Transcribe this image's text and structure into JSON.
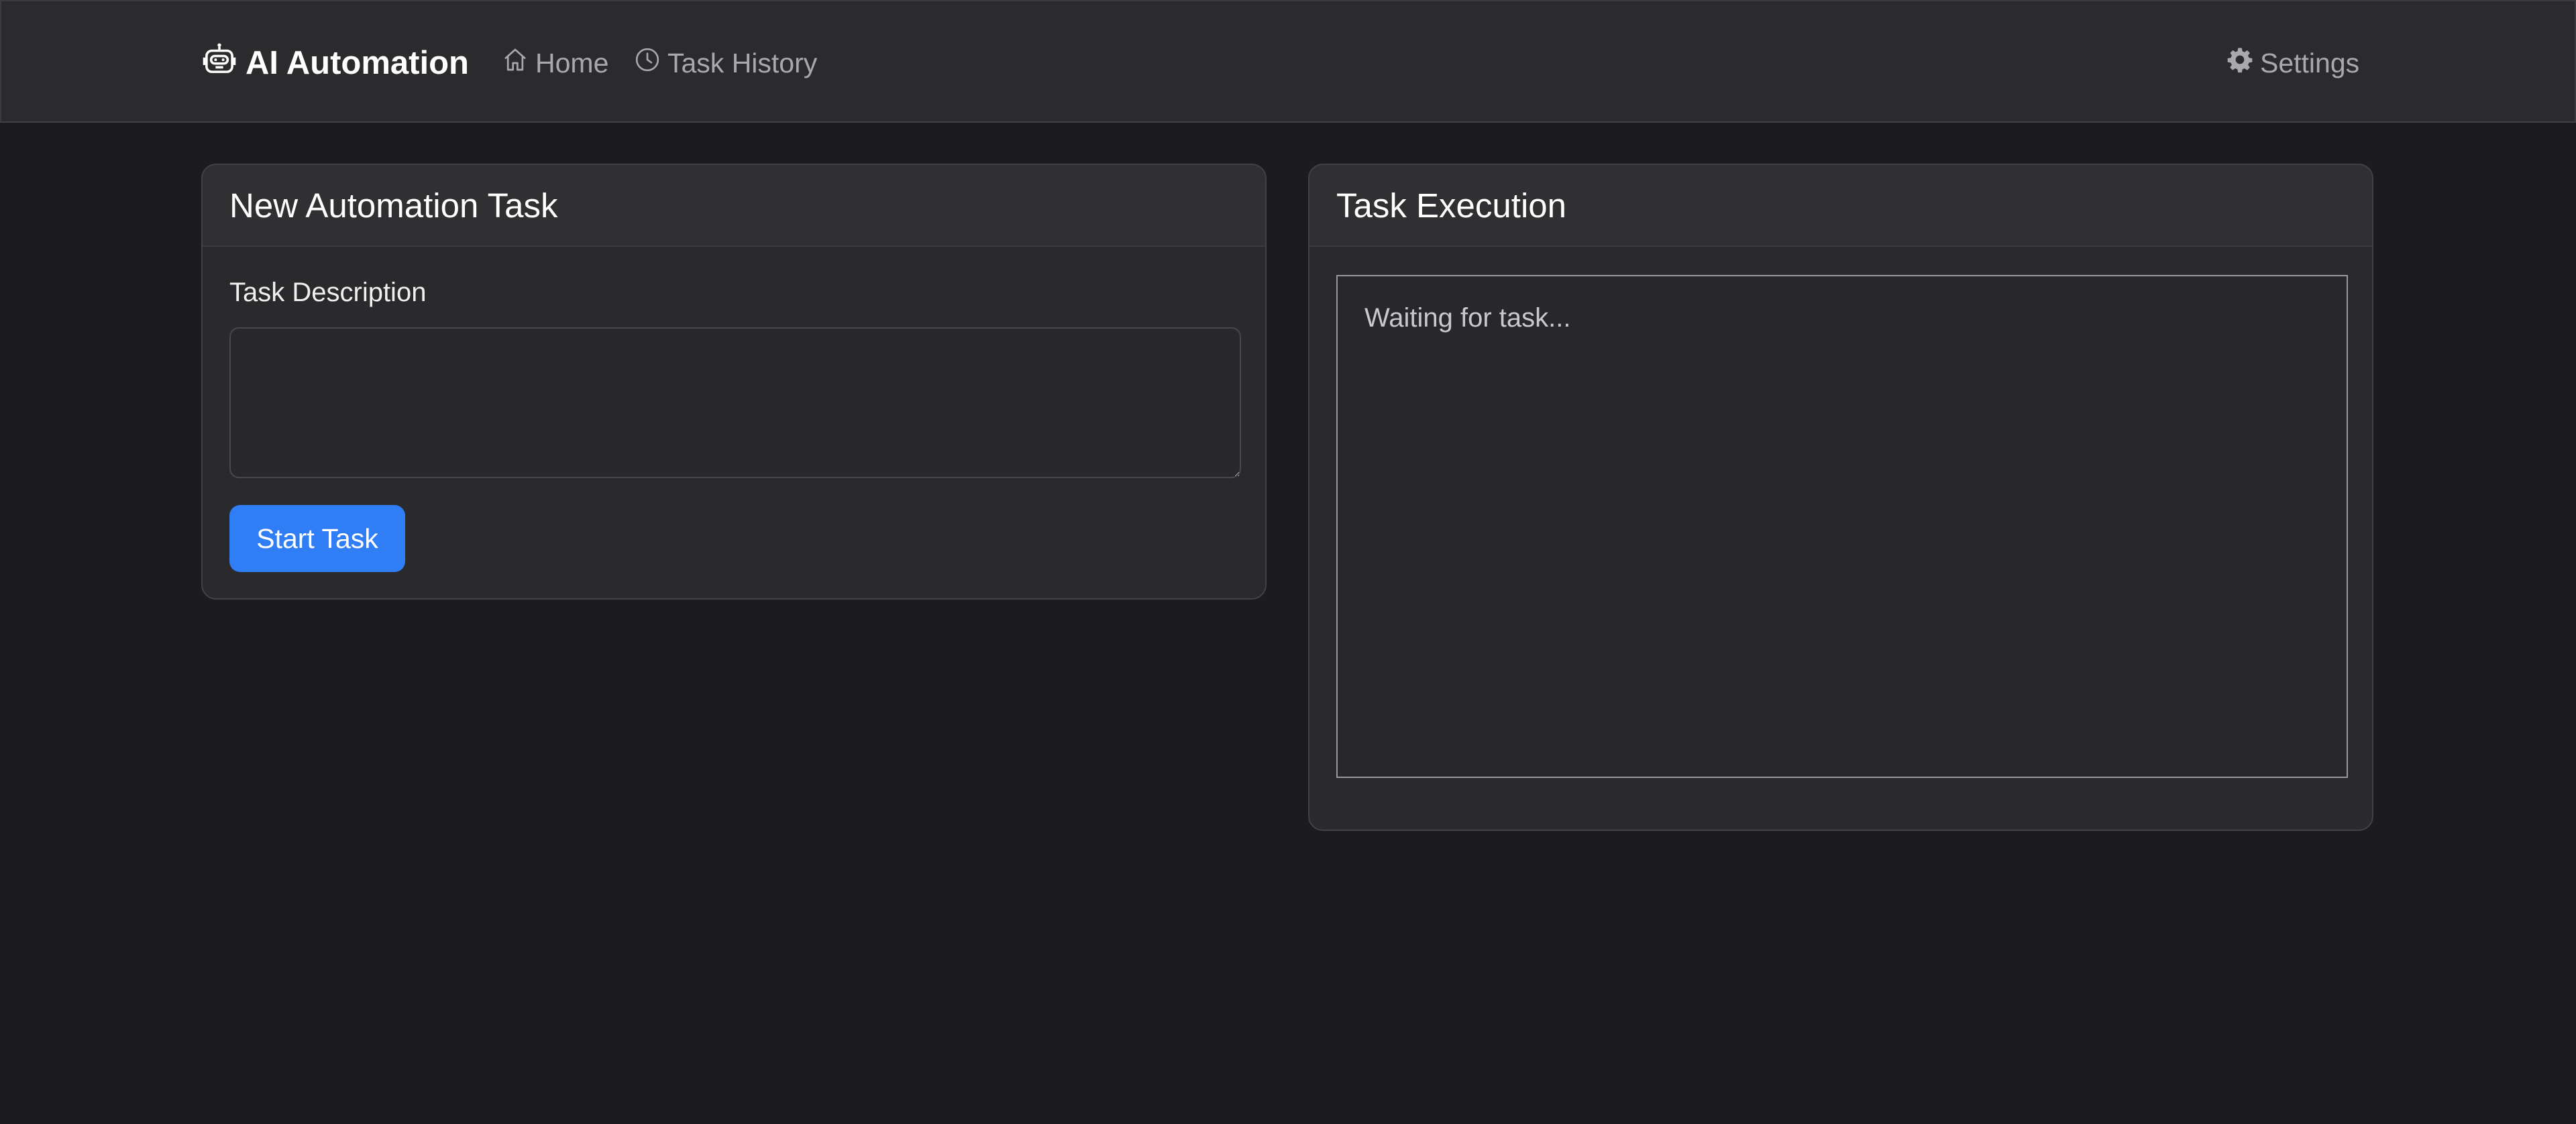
{
  "navbar": {
    "brand": "AI Automation",
    "brand_icon": "robot-icon",
    "links": [
      {
        "label": "Home",
        "icon": "home-icon"
      },
      {
        "label": "Task History",
        "icon": "clock-icon"
      }
    ],
    "settings": {
      "label": "Settings",
      "icon": "gear-icon"
    }
  },
  "task_card": {
    "title": "New Automation Task",
    "description_label": "Task Description",
    "description_value": "",
    "start_button": "Start Task"
  },
  "execution_card": {
    "title": "Task Execution",
    "status_text": "Waiting for task..."
  },
  "colors": {
    "background": "#1c1c1e",
    "navbar": "#2b2b2d",
    "card": "#2a2a2c",
    "primary": "#2f7ef6",
    "muted_text": "#a9a9ad"
  }
}
